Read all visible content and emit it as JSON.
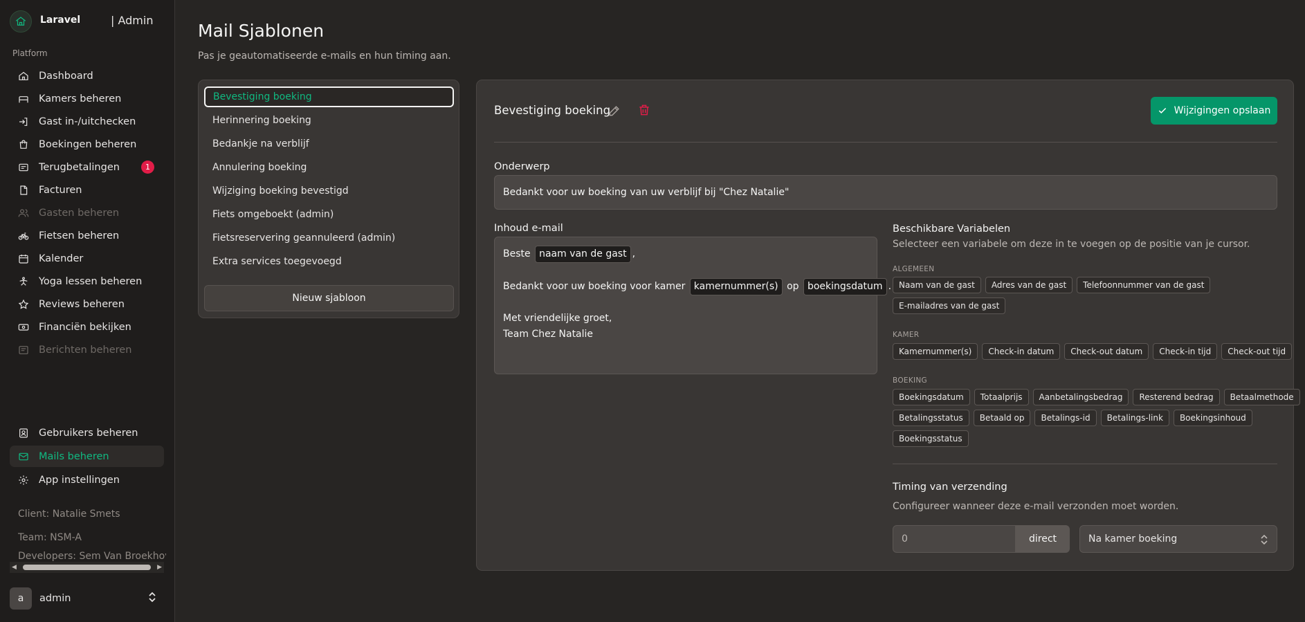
{
  "brand": {
    "name": "Laravel",
    "suffix": "| Admin"
  },
  "sidebar": {
    "group_label": "Platform",
    "items": [
      {
        "label": "Dashboard",
        "icon": "home-icon"
      },
      {
        "label": "Kamers beheren",
        "icon": "bed-icon"
      },
      {
        "label": "Gast in-/uitchecken",
        "icon": "door-enter-icon"
      },
      {
        "label": "Boekingen beheren",
        "icon": "bag-icon"
      },
      {
        "label": "Terugbetalingen",
        "icon": "receipt-icon",
        "badge": "1"
      },
      {
        "label": "Facturen",
        "icon": "document-icon"
      },
      {
        "label": "Gasten beheren",
        "icon": "users-icon",
        "disabled": true
      },
      {
        "label": "Fietsen beheren",
        "icon": "bike-icon"
      },
      {
        "label": "Kalender",
        "icon": "calendar-icon"
      },
      {
        "label": "Yoga lessen beheren",
        "icon": "yoga-icon"
      },
      {
        "label": "Reviews beheren",
        "icon": "star-icon"
      },
      {
        "label": "Financiën bekijken",
        "icon": "banknote-icon"
      },
      {
        "label": "Berichten beheren",
        "icon": "message-icon",
        "disabled": true
      }
    ],
    "bottom_items": [
      {
        "label": "Gebruikers beheren",
        "icon": "user-badge-icon"
      },
      {
        "label": "Mails beheren",
        "icon": "mail-icon",
        "active": true
      },
      {
        "label": "App instellingen",
        "icon": "gear-icon"
      }
    ],
    "meta": {
      "client": "Client: Natalie Smets",
      "team": "Team: NSM-A",
      "developers": "Developers: Sem Van Broekhove"
    },
    "user": {
      "initial": "a",
      "name": "admin"
    }
  },
  "page": {
    "title": "Mail Sjablonen",
    "subtitle": "Pas je geautomatiseerde e-mails en hun timing aan."
  },
  "templates": {
    "items": [
      "Bevestiging boeking",
      "Herinnering boeking",
      "Bedankje na verblijf",
      "Annulering boeking",
      "Wijziging boeking bevestigd",
      "Fiets omgeboekt (admin)",
      "Fietsreservering geannuleerd (admin)",
      "Extra services toegevoegd"
    ],
    "new_label": "Nieuw sjabloon"
  },
  "editor": {
    "title": "Bevestiging boeking",
    "save_label": "Wijzigingen opslaan",
    "subject_label": "Onderwerp",
    "subject_value": "Bedankt voor uw boeking van uw verblijf bij \"Chez Natalie\"",
    "body_label": "Inhoud e-mail",
    "body": {
      "greet": "Beste",
      "var_name": "naam van de gast",
      "comma": ",",
      "thanks": "Bedankt voor uw boeking voor kamer",
      "var_room": "kamernummer(s)",
      "op": "op",
      "var_date": "boekingsdatum",
      "period": ".",
      "closing": "Met vriendelijke groet,",
      "signature": "Team Chez Natalie"
    },
    "vars_title": "Beschikbare Variabelen",
    "vars_desc": "Selecteer een variabele om deze in te voegen op de positie van je cursor.",
    "categories": {
      "algemeen": {
        "label": "ALGEMEEN",
        "rows": [
          [
            "Naam van de gast",
            "Adres van de gast",
            "Telefoonnummer van de gast"
          ],
          [
            "E-mailadres van de gast"
          ]
        ]
      },
      "kamer": {
        "label": "KAMER",
        "rows": [
          [
            "Kamernummer(s)",
            "Check-in datum",
            "Check-out datum",
            "Check-in tijd",
            "Check-out tijd"
          ]
        ]
      },
      "boeking": {
        "label": "BOEKING",
        "rows": [
          [
            "Boekingsdatum",
            "Totaalprijs",
            "Aanbetalingsbedrag",
            "Resterend bedrag",
            "Betaalmethode"
          ],
          [
            "Betalingsstatus",
            "Betaald op",
            "Betalings-id",
            "Betalings-link",
            "Boekingsinhoud"
          ],
          [
            "Boekingsstatus"
          ]
        ]
      }
    },
    "timing": {
      "title": "Timing van verzending",
      "desc": "Configureer wanneer deze e-mail verzonden moet worden.",
      "value": "0",
      "unit": "direct",
      "trigger": "Na kamer boeking"
    }
  },
  "colors": {
    "accent": "#10b981",
    "save": "#059669",
    "danger": "#e11d48"
  }
}
